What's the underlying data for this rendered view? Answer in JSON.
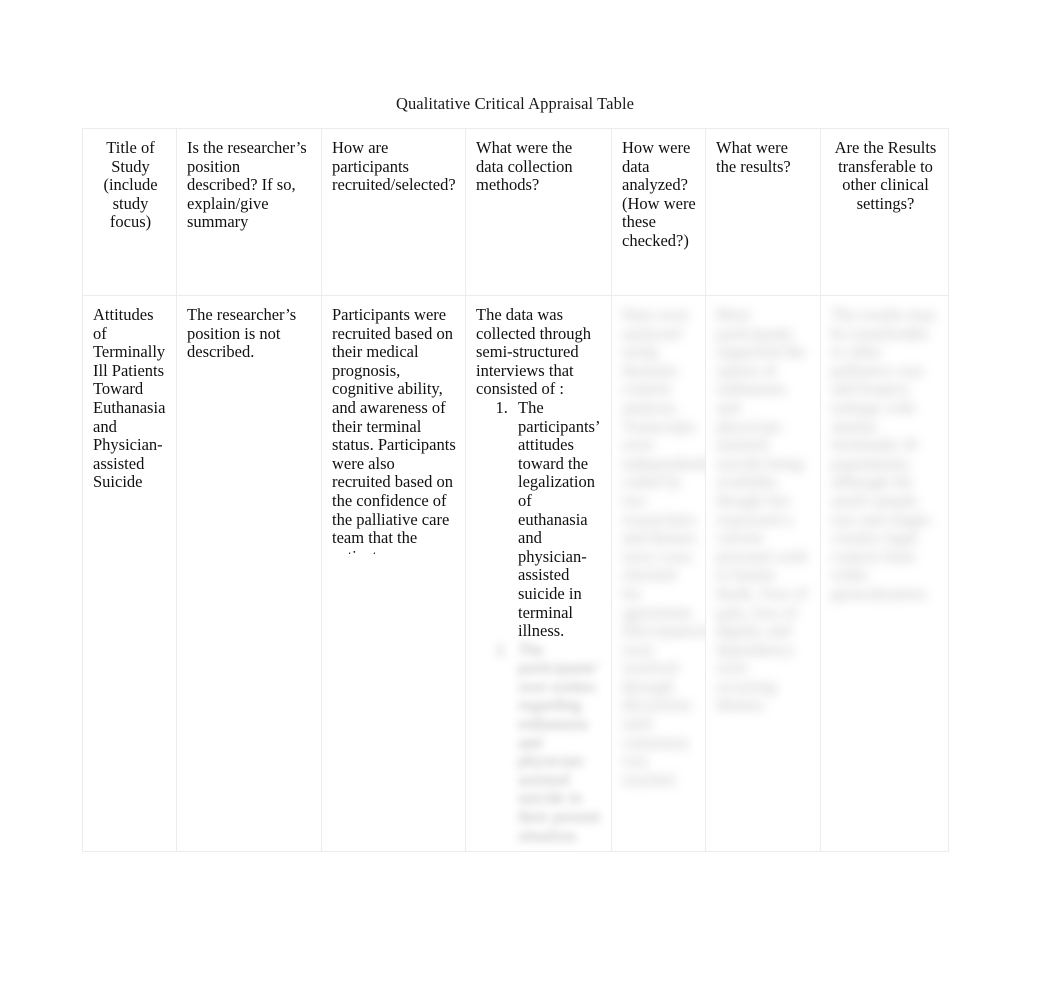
{
  "document": {
    "title": "Qualitative Critical Appraisal Table",
    "background_color": "#ffffff",
    "text_color": "#111111",
    "border_color": "#ececec"
  },
  "table": {
    "name": "qualitative-critical-appraisal-table",
    "column_count": 7,
    "row_count": 2,
    "headers": [
      {
        "id": "title-of-study",
        "label": "Title of Study (include study focus)",
        "align": "center"
      },
      {
        "id": "researcher-position",
        "label": "Is the researcher’s position described? If so, explain/give summary",
        "align": "left"
      },
      {
        "id": "participant-recruitment",
        "label": "How are participants recruited/selected?",
        "align": "left"
      },
      {
        "id": "data-collection-methods",
        "label": "What were the data collection methods?",
        "align": "left"
      },
      {
        "id": "data-analysis",
        "label": "How were data analyzed? (How were these checked?)",
        "align": "left"
      },
      {
        "id": "results",
        "label": "What were the results?",
        "align": "left"
      },
      {
        "id": "transferability",
        "label": "Are the Results transferable to other clinical settings?",
        "align": "center"
      }
    ],
    "rows": [
      {
        "id": "study-row-1",
        "cells": {
          "title_of_study": {
            "text": "Attitudes of Terminally Ill Patients Toward Euthanasia and Physician-assisted Suicide",
            "redacted": false
          },
          "researcher_position": {
            "text": "The researcher’s position is not described.",
            "redacted": false
          },
          "participant_recruitment": {
            "text": "Participants were recruited based on their medical prognosis, cognitive ability, and awareness of their terminal status. Participants were also recruited based on the confidence of the palliative care team that the patients can discuss euthanasia and physician-assisted suicide without undue distress during the interview process.",
            "redacted": false,
            "clipped": true
          },
          "data_collection_methods": {
            "intro": "The data was collected through semi-structured interviews that consisted of :",
            "list": [
              "The participants’ attitudes toward the legalization of euthanasia and physician-assisted suicide in terminal illness.",
              "The participants’ own wishes regarding euthanasia and physician-assisted suicide in their present situation."
            ],
            "redacted": true,
            "redacted_from_item": 1
          },
          "data_analysis": {
            "text": "Data were analyzed using thematic content analysis. Transcripts were independently coded by two researchers and themes were cross checked for agreement. Discrepancies were resolved through discussion until consensus was reached.",
            "redacted": true
          },
          "results": {
            "text": "Most participants supported the option of euthanasia and physician-assisted suicide being available, though few expressed a current personal wish to hasten death. Fear of pain, loss of dignity and dependency were recurring themes.",
            "redacted": true
          },
          "transferability": {
            "text": "The results may be transferable to other palliative care and hospice settings with similar terminally ill populations, although the small sample size and single-country legal context limit wider generalization.",
            "redacted": true
          }
        }
      }
    ]
  }
}
